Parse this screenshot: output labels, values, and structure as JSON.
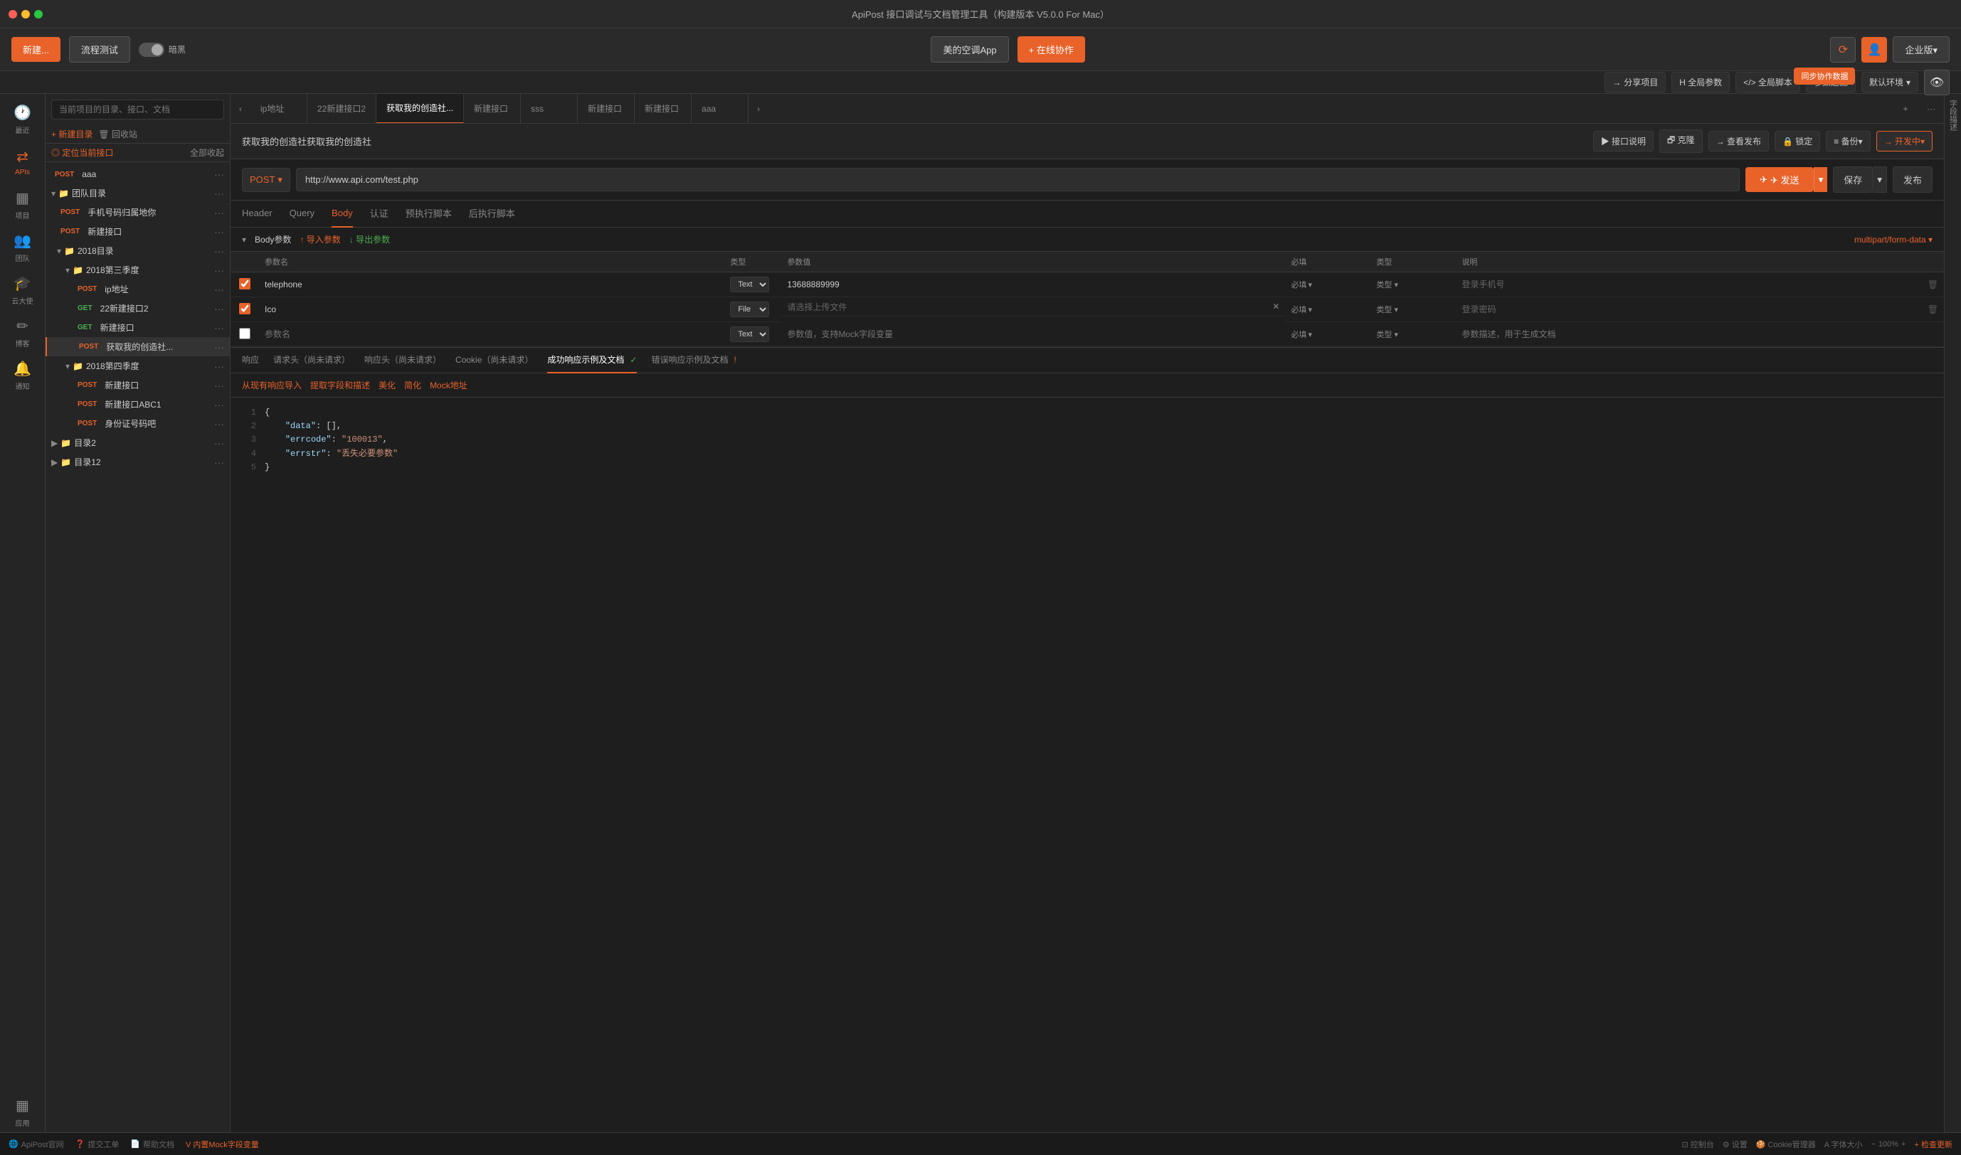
{
  "app": {
    "title": "ApiPost 接口调试与文档管理工具（构建版本 V5.0.0 For Mac）",
    "titlebar_dots": [
      "red",
      "yellow",
      "green"
    ]
  },
  "toolbar": {
    "new_label": "新建...",
    "flow_label": "流程测试",
    "dark_label": "暗黑",
    "app_button": "美的空调App",
    "collab_button": "+ 在线协作",
    "sync_tooltip": "同步协作数据",
    "enterprise_label": "企业版▾"
  },
  "top_actions": {
    "share": "分享项目",
    "global_params": "H 全局参数",
    "global_scripts": "</> 全局脚本",
    "param_filters": "参数过滤",
    "default_env": "默认环境"
  },
  "sidebar_icons": [
    {
      "name": "recent",
      "label": "最近",
      "icon": "🕐"
    },
    {
      "name": "apis",
      "label": "APIs",
      "icon": "⇄"
    },
    {
      "name": "project",
      "label": "项目",
      "icon": "▦"
    },
    {
      "name": "team",
      "label": "团队",
      "icon": "👥"
    },
    {
      "name": "cloud",
      "label": "云大使",
      "icon": "🎓"
    },
    {
      "name": "blog",
      "label": "博客",
      "icon": "✏"
    },
    {
      "name": "notify",
      "label": "通知",
      "icon": "🔔"
    },
    {
      "name": "apps",
      "label": "应用",
      "icon": "▦"
    }
  ],
  "left_panel": {
    "search_placeholder": "当前项目的目录、接口、文档",
    "new_dir": "+ 新建目录",
    "recycle": "🗑 回收站",
    "locate": "◎ 定位当前接口",
    "collapse_all": "全部收起",
    "tree": [
      {
        "type": "method",
        "method": "POST",
        "label": "aaa",
        "indent": 0
      },
      {
        "type": "folder",
        "label": "团队目录",
        "indent": 0
      },
      {
        "type": "method",
        "method": "POST",
        "label": "手机号码归属地你",
        "indent": 1
      },
      {
        "type": "method",
        "method": "POST",
        "label": "新建接口",
        "indent": 1
      },
      {
        "type": "folder",
        "label": "2018目录",
        "indent": 1
      },
      {
        "type": "folder",
        "label": "2018第三季度",
        "indent": 2
      },
      {
        "type": "method",
        "method": "POST",
        "label": "ip地址",
        "indent": 3
      },
      {
        "type": "method",
        "method": "GET",
        "label": "22新建接口2",
        "indent": 3
      },
      {
        "type": "method",
        "method": "GET",
        "label": "新建接口",
        "indent": 3
      },
      {
        "type": "method",
        "method": "POST",
        "label": "获取我的创造社...",
        "indent": 3,
        "active": true
      },
      {
        "type": "folder",
        "label": "2018第四季度",
        "indent": 2
      },
      {
        "type": "method",
        "method": "POST",
        "label": "新建接口",
        "indent": 3
      },
      {
        "type": "method",
        "method": "POST",
        "label": "新建接口ABC1",
        "indent": 3
      },
      {
        "type": "method",
        "method": "POST",
        "label": "身份证号码吧",
        "indent": 3
      },
      {
        "type": "folder",
        "label": "目录2",
        "indent": 0
      },
      {
        "type": "folder",
        "label": "目录12",
        "indent": 0
      }
    ]
  },
  "tabs": [
    {
      "label": "ip地址"
    },
    {
      "label": "22新建接口2"
    },
    {
      "label": "获取我的创造社...",
      "active": true
    },
    {
      "label": "新建接口"
    },
    {
      "label": "sss"
    },
    {
      "label": "新建接口"
    },
    {
      "label": "新建接口"
    },
    {
      "label": "aaa"
    }
  ],
  "interface": {
    "title": "获取我的创造社获取我的创造社",
    "buttons": [
      {
        "label": "▶ 接口说明"
      },
      {
        "label": "🗗 克隆"
      },
      {
        "label": "→ 查看发布"
      },
      {
        "label": "🔒 锁定"
      },
      {
        "label": "≡ 备份▾"
      },
      {
        "label": "→ 开发中▾"
      }
    ]
  },
  "url_bar": {
    "method": "POST",
    "url": "http://www.api.com/test.php",
    "send": "✈ 发送",
    "save": "保存",
    "publish": "发布"
  },
  "sub_tabs": [
    {
      "label": "Header"
    },
    {
      "label": "Query"
    },
    {
      "label": "Body",
      "active": true
    },
    {
      "label": "认证"
    },
    {
      "label": "预执行脚本"
    },
    {
      "label": "后执行脚本"
    }
  ],
  "body_params": {
    "title": "Body参数",
    "import": "↑ 导入参数",
    "export": "↓ 导出参数",
    "content_type": "multipart/form-data ▾",
    "rows": [
      {
        "checked": true,
        "name": "telephone",
        "type": "Text",
        "value": "13688889999",
        "required": "必填",
        "type_label": "类型",
        "desc_placeholder": "登录手机号"
      },
      {
        "checked": true,
        "name": "Ico",
        "type": "File",
        "value": "请选择上传文件",
        "required": "必填",
        "type_label": "类型",
        "desc_placeholder": "登录密码"
      },
      {
        "checked": false,
        "name": "",
        "name_placeholder": "参数名",
        "type": "Text",
        "value": "",
        "value_placeholder": "参数值，支持Mock字段变量",
        "required": "必填",
        "type_label": "类型",
        "desc_placeholder": "参数描述，用于生成文档"
      }
    ]
  },
  "response_tabs": [
    {
      "label": "响应"
    },
    {
      "label": "请求头（尚未请求）"
    },
    {
      "label": "响应头（尚未请求）"
    },
    {
      "label": "Cookie（尚未请求）"
    },
    {
      "label": "成功响应示例及文档",
      "active": true,
      "badge": "✓"
    },
    {
      "label": "错误响应示例及文档",
      "badge": "!"
    }
  ],
  "resp_actions": [
    {
      "label": "从现有响应导入",
      "icon": "←"
    },
    {
      "label": "提取字段和描述",
      "icon": "📄"
    },
    {
      "label": "美化",
      "icon": "✦"
    },
    {
      "label": "简化",
      "icon": "≡"
    },
    {
      "label": "Mock地址",
      "icon": "🔗"
    }
  ],
  "code_content": [
    {
      "num": "1",
      "content": "{"
    },
    {
      "num": "2",
      "content": "    \"data\": [],"
    },
    {
      "num": "3",
      "content": "    \"errcode\": \"100013\","
    },
    {
      "num": "4",
      "content": "    \"errstr\": \"丢失必要参数\""
    },
    {
      "num": "5",
      "content": "}"
    }
  ],
  "bottom_bar": {
    "items": [
      {
        "label": "ApiPost官网"
      },
      {
        "label": "提交工单"
      },
      {
        "label": "帮助文档"
      },
      {
        "label": "V 内置Mock字段变量",
        "orange": true
      }
    ],
    "right_items": [
      {
        "label": "⊡ 控制台"
      },
      {
        "label": "⚙ 设置"
      },
      {
        "label": "🍪 Cookie管理器"
      },
      {
        "label": "A 字体大小"
      },
      {
        "label": "100%"
      },
      {
        "label": "+ 检查更新"
      }
    ]
  },
  "sidebar_right": {
    "labels": [
      "字",
      "段",
      "描",
      "述"
    ]
  }
}
